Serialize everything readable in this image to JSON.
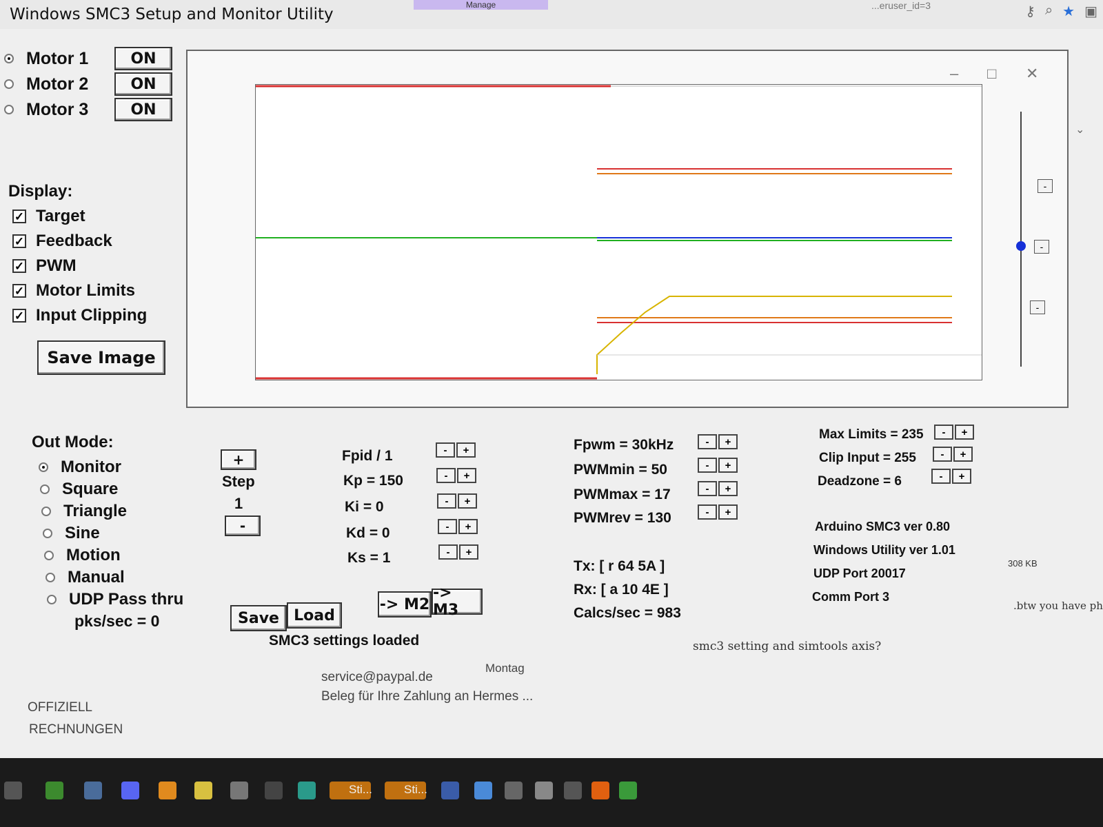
{
  "window": {
    "title": "Windows SMC3 Setup and Monitor Utility",
    "tab_manage": "Manage",
    "url_fragment": "...eruser_id=3"
  },
  "motors": [
    {
      "label": "Motor 1",
      "button": "ON",
      "selected": true
    },
    {
      "label": "Motor 2",
      "button": "ON",
      "selected": false
    },
    {
      "label": "Motor 3",
      "button": "ON",
      "selected": false
    }
  ],
  "display": {
    "heading": "Display:",
    "options": [
      {
        "label": "Target",
        "checked": true
      },
      {
        "label": "Feedback",
        "checked": true
      },
      {
        "label": "PWM",
        "checked": true
      },
      {
        "label": "Motor Limits",
        "checked": true
      },
      {
        "label": "Input Clipping",
        "checked": true
      }
    ],
    "save_image": "Save Image"
  },
  "plot": {
    "colors": {
      "limits": "#d83030",
      "target": "#20b020",
      "feedback": "#1530d8",
      "pwm": "#d8b400",
      "clipping": "#e07818"
    }
  },
  "out_mode": {
    "heading": "Out Mode:",
    "options": [
      {
        "label": "Monitor",
        "selected": true
      },
      {
        "label": "Square",
        "selected": false
      },
      {
        "label": "Triangle",
        "selected": false
      },
      {
        "label": "Sine",
        "selected": false
      },
      {
        "label": "Motion",
        "selected": false
      },
      {
        "label": "Manual",
        "selected": false
      },
      {
        "label": "UDP Pass thru",
        "selected": false
      }
    ],
    "pks_sec": "pks/sec = 0"
  },
  "step": {
    "plus": "+",
    "label": "Step",
    "value": "1",
    "minus": "-"
  },
  "pid": {
    "fpid": "Fpid / 1",
    "kp": "Kp = 150",
    "ki": "Ki = 0",
    "kd": "Kd = 0",
    "ks": "Ks = 1"
  },
  "pwm": {
    "fpwm": "Fpwm = 30kHz",
    "pwmmin": "PWMmin = 50",
    "pwmmax": "PWMmax = 17",
    "pwmrev": "PWMrev = 130"
  },
  "limits": {
    "max": "Max Limits = 235",
    "clip": "Clip Input = 255",
    "deadzone": "Deadzone = 6"
  },
  "comm": {
    "tx": "Tx: [ r 64 5A ]",
    "rx": "Rx: [ a 10 4E ]",
    "calcs": "Calcs/sec = 983"
  },
  "info": {
    "arduino": "Arduino SMC3 ver 0.80",
    "windows": "Windows Utility ver 1.01",
    "udp": "UDP Port 20017",
    "comm_port": "Comm Port 3"
  },
  "actions": {
    "save": "Save",
    "load": "Load",
    "to_m2": "-> M2",
    "to_m3": "-> M3",
    "status": "SMC3 settings loaded"
  },
  "pm_button": {
    "minus": "-",
    "plus": "+"
  },
  "background": {
    "mail_from": "service@paypal.de",
    "mail_subject": "Beleg für Ihre Zahlung an Hermes ...",
    "mail_day": "Montag",
    "folder_1": "OFFIZIELL",
    "folder_2": "RECHNUNGEN",
    "comment": "smc3 setting and simtools axis?",
    "comment_right": ".btw you have ph",
    "file_size": "308 KB",
    "taskbar_sti1": "Sti...",
    "taskbar_sti2": "Sti..."
  }
}
